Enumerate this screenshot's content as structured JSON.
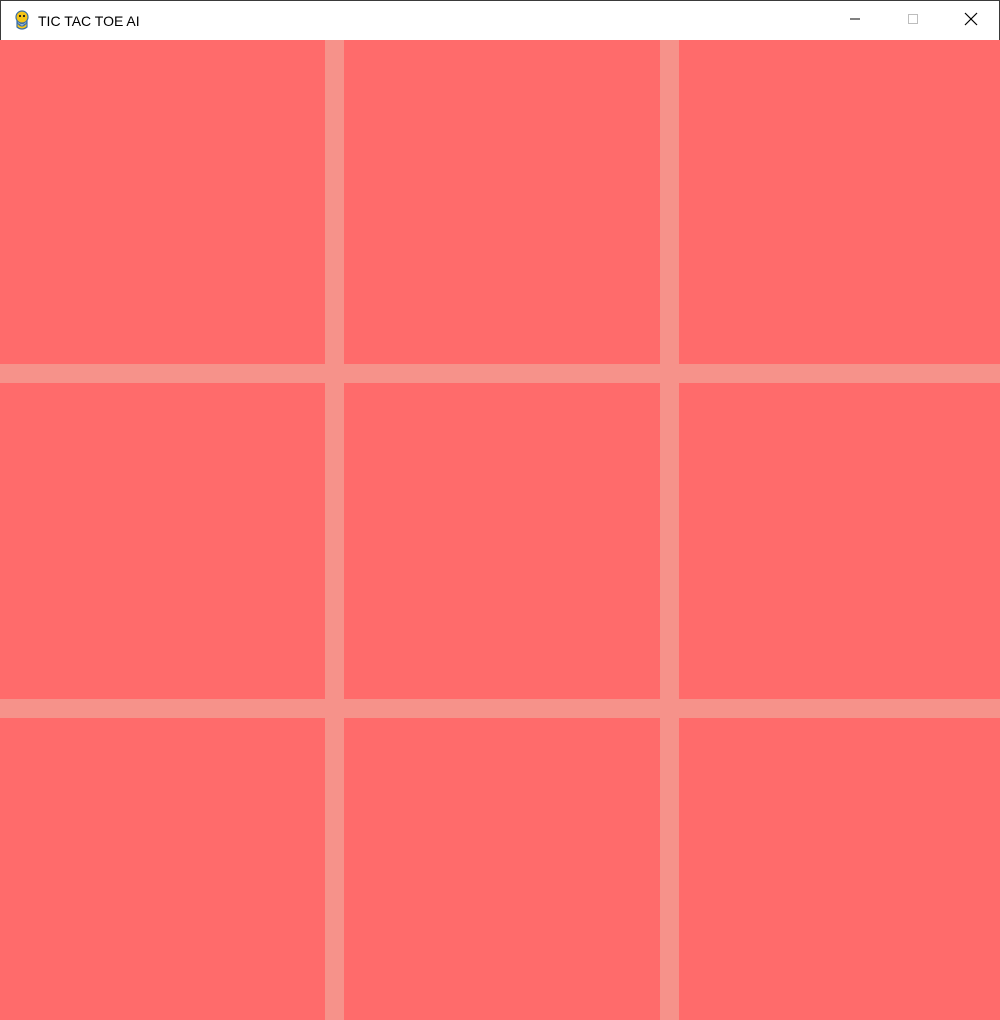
{
  "window": {
    "title": "TIC TAC TOE AI",
    "icon": "pygame-snake-icon",
    "controls": [
      "minimize-icon",
      "maximize-icon",
      "close-icon"
    ]
  },
  "board": {
    "rows": 3,
    "cols": 3,
    "cells": [
      "",
      "",
      "",
      "",
      "",
      "",
      "",
      "",
      ""
    ],
    "colors": {
      "background": "#ff6b6b",
      "grid_lines": "#f6928a"
    }
  }
}
